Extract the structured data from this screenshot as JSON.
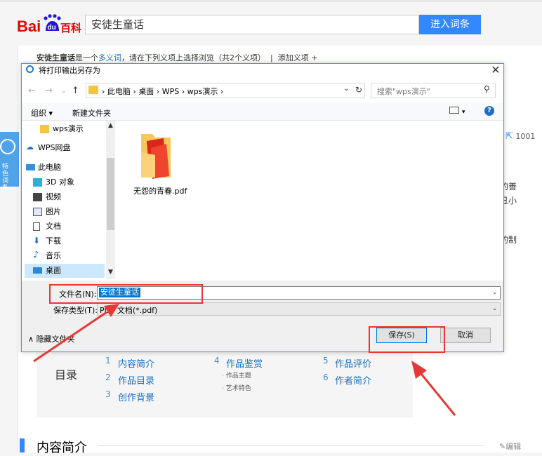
{
  "baidu": {
    "logo_text_a": "Bai",
    "logo_text_b": "du",
    "logo_text_c": "百科",
    "search_value": "安徒生童话",
    "search_button": "进入词条"
  },
  "page": {
    "polysemy_term": "安徒生童话",
    "polysemy_text_a": "是一个",
    "polysemy_link": "多义词",
    "polysemy_text_b": "，请在下列义项上选择浏览（共2个义项）",
    "add_sense": "添加义项 +",
    "side_badge": "特色词条",
    "share_count": "1001",
    "right_fragments": [
      "的善",
      "丑小",
      "的制"
    ]
  },
  "dialog": {
    "title": "将打印输出另存为",
    "close_glyph": "✕",
    "breadcrumbs": [
      "此电脑",
      "桌面",
      "WPS",
      "wps演示"
    ],
    "search_placeholder": "搜索\"wps演示\"",
    "organize": "组织 ▾",
    "new_folder": "新建文件夹",
    "help_glyph": "?",
    "nav_items": [
      {
        "label": "wps演示",
        "icon": "folder-icon",
        "selected": false
      },
      {
        "label": "WPS网盘",
        "icon": "cloud-icon",
        "selected": false
      },
      {
        "label": "此电脑",
        "icon": "computer-icon",
        "selected": false
      },
      {
        "label": "3D 对象",
        "icon": "3d-object-icon",
        "selected": false
      },
      {
        "label": "视频",
        "icon": "video-icon",
        "selected": false
      },
      {
        "label": "图片",
        "icon": "picture-icon",
        "selected": false
      },
      {
        "label": "文档",
        "icon": "document-icon",
        "selected": false
      },
      {
        "label": "下载",
        "icon": "download-icon",
        "selected": false
      },
      {
        "label": "音乐",
        "icon": "music-icon",
        "selected": false
      },
      {
        "label": "桌面",
        "icon": "desktop-icon",
        "selected": true
      }
    ],
    "file_name": "无怨的青春.pdf",
    "filename_label": "文件名(N):",
    "filename_value": "安徒生童话",
    "filetype_label": "保存类型(T):",
    "filetype_value": "PDF 文档(*.pdf)",
    "hide_folders": "隐藏文件夹",
    "save_button": "保存(S)",
    "cancel_button": "取消"
  },
  "toc": {
    "heading": "目录",
    "items": [
      {
        "num": "1",
        "label": "内容简介"
      },
      {
        "num": "2",
        "label": "作品目录"
      },
      {
        "num": "3",
        "label": "创作背景"
      },
      {
        "num": "4",
        "label": "作品鉴赏"
      },
      {
        "num": "5",
        "label": "作品评价"
      },
      {
        "num": "6",
        "label": "作者简介"
      }
    ],
    "sub_items": [
      "作品主题",
      "艺术特色"
    ]
  },
  "section": {
    "title": "内容简介",
    "edit": "编辑"
  },
  "colors": {
    "baidu_red": "#e10602",
    "baidu_blue": "#2319dc",
    "link_blue": "#136ec2",
    "annotation_red": "#e53935"
  }
}
